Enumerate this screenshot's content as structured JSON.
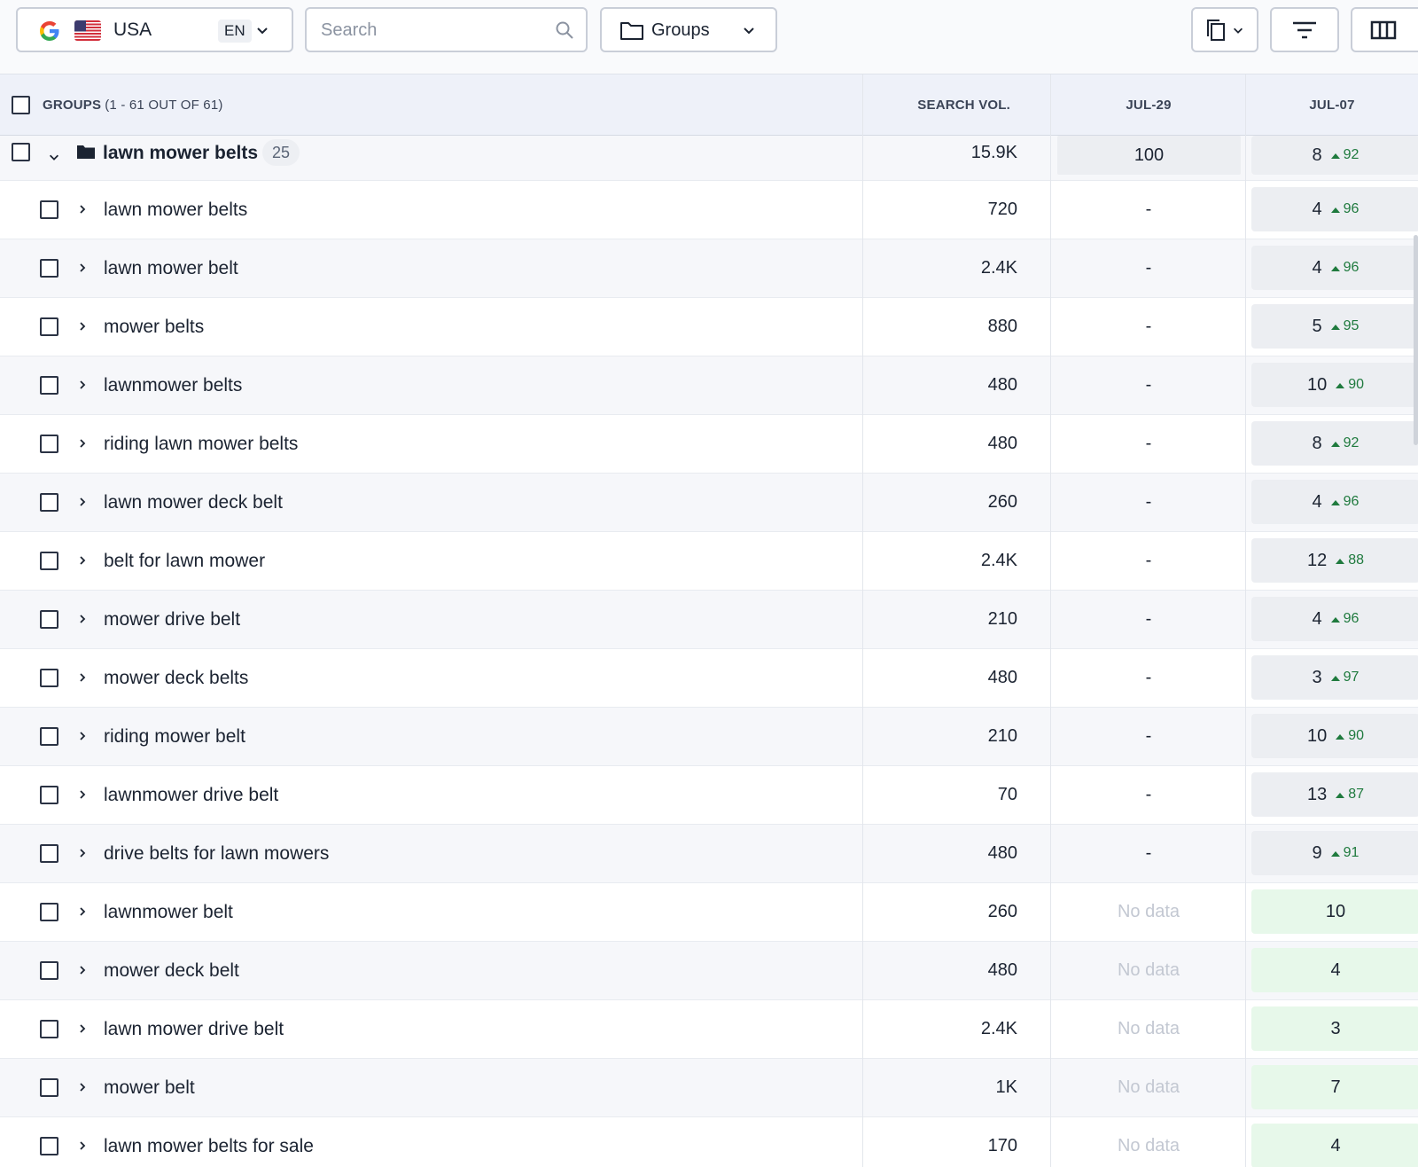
{
  "toolbar": {
    "location": "USA",
    "language": "EN",
    "search_placeholder": "Search",
    "groups_label": "Groups"
  },
  "table": {
    "header": {
      "groups_label": "GROUPS",
      "groups_count": "(1 - 61 OUT OF 61)",
      "search_vol": "SEARCH VOL.",
      "col_jul29": "JUL-29",
      "col_jul07": "JUL-07"
    },
    "group": {
      "name": "lawn mower belts",
      "count": "25",
      "volume": "15.9K",
      "jul29": "100",
      "jul07_rank": "8",
      "jul07_delta": "92"
    },
    "rows": [
      {
        "keyword": "lawn mower belts",
        "volume": "720",
        "jul29": "-",
        "rank": "4",
        "delta": "96"
      },
      {
        "keyword": "lawn mower belt",
        "volume": "2.4K",
        "jul29": "-",
        "rank": "4",
        "delta": "96"
      },
      {
        "keyword": "mower belts",
        "volume": "880",
        "jul29": "-",
        "rank": "5",
        "delta": "95"
      },
      {
        "keyword": "lawnmower belts",
        "volume": "480",
        "jul29": "-",
        "rank": "10",
        "delta": "90"
      },
      {
        "keyword": "riding lawn mower belts",
        "volume": "480",
        "jul29": "-",
        "rank": "8",
        "delta": "92"
      },
      {
        "keyword": "lawn mower deck belt",
        "volume": "260",
        "jul29": "-",
        "rank": "4",
        "delta": "96"
      },
      {
        "keyword": "belt for lawn mower",
        "volume": "2.4K",
        "jul29": "-",
        "rank": "12",
        "delta": "88"
      },
      {
        "keyword": "mower drive belt",
        "volume": "210",
        "jul29": "-",
        "rank": "4",
        "delta": "96"
      },
      {
        "keyword": "mower deck belts",
        "volume": "480",
        "jul29": "-",
        "rank": "3",
        "delta": "97"
      },
      {
        "keyword": "riding mower belt",
        "volume": "210",
        "jul29": "-",
        "rank": "10",
        "delta": "90"
      },
      {
        "keyword": "lawnmower drive belt",
        "volume": "70",
        "jul29": "-",
        "rank": "13",
        "delta": "87"
      },
      {
        "keyword": "drive belts for lawn mowers",
        "volume": "480",
        "jul29": "-",
        "rank": "9",
        "delta": "91"
      },
      {
        "keyword": "lawnmower belt",
        "volume": "260",
        "jul29": "No data",
        "rank": "10",
        "delta": ""
      },
      {
        "keyword": "mower deck belt",
        "volume": "480",
        "jul29": "No data",
        "rank": "4",
        "delta": ""
      },
      {
        "keyword": "lawn mower drive belt",
        "volume": "2.4K",
        "jul29": "No data",
        "rank": "3",
        "delta": ""
      },
      {
        "keyword": "mower belt",
        "volume": "1K",
        "jul29": "No data",
        "rank": "7",
        "delta": ""
      },
      {
        "keyword": "lawn mower belts for sale",
        "volume": "170",
        "jul29": "No data",
        "rank": "4",
        "delta": ""
      }
    ]
  },
  "icons": {
    "search": "search-icon",
    "folder": "folder-icon",
    "chevron": "chevron-down-icon",
    "copy": "copy-icon",
    "filter": "filter-icon",
    "columns": "columns-icon",
    "google": "google-logo-icon",
    "flag": "us-flag-icon"
  },
  "colors": {
    "positive_delta": "#1f7a3e",
    "top_rank_bg": "#e7f8ea",
    "header_bg": "#eef1f9"
  }
}
